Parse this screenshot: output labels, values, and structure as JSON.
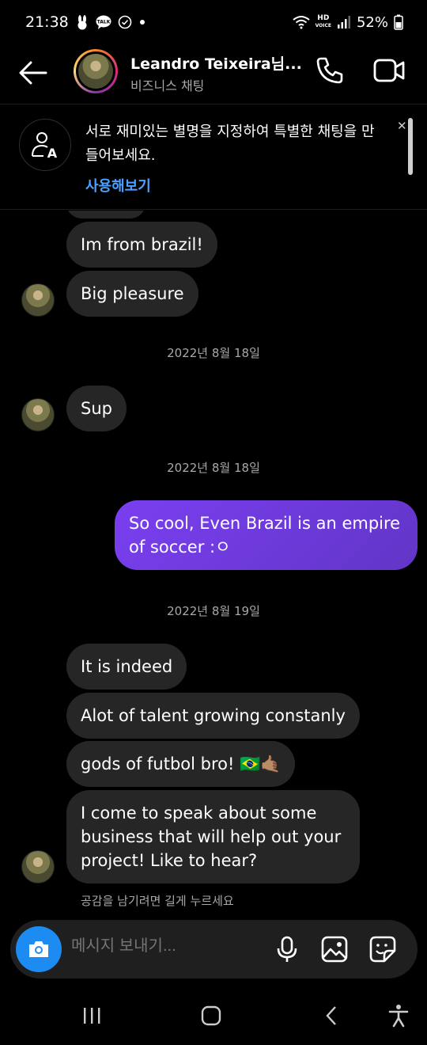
{
  "status_bar": {
    "time": "21:38",
    "battery": "52%",
    "hd_label": "HD",
    "voice_label": "VOICE"
  },
  "header": {
    "name": "Leandro Teixeira님...",
    "subtitle": "비즈니스 채팅"
  },
  "banner": {
    "text": "서로 재미있는 별명을 지정하여 특별한 채팅을 만들어보세요.",
    "action": "사용해보기"
  },
  "messages": {
    "in_1": "Im from brazil!",
    "in_2": "Big pleasure",
    "date_1": "2022년 8월 18일",
    "in_3": "Sup",
    "date_2": "2022년 8월 18일",
    "out_1": "So cool, Even Brazil is an empire of soccer :ㅇ",
    "date_3": "2022년 8월 19일",
    "in_4": "It is indeed",
    "in_5": "Alot of talent growing constanly",
    "in_6": "gods of futbol bro! 🇧🇷🤙🏽",
    "in_7": "I come to speak about some business that will help out your project! Like to hear?",
    "hint": "공감을 남기려면 길게 누르세요"
  },
  "composer": {
    "placeholder": "메시지 보내기..."
  },
  "colors": {
    "background": "#000000",
    "incoming_bubble": "#262626",
    "outgoing_bubble": "#6f3be0",
    "link": "#4ca0ff",
    "camera_button": "#1d8cf2"
  }
}
